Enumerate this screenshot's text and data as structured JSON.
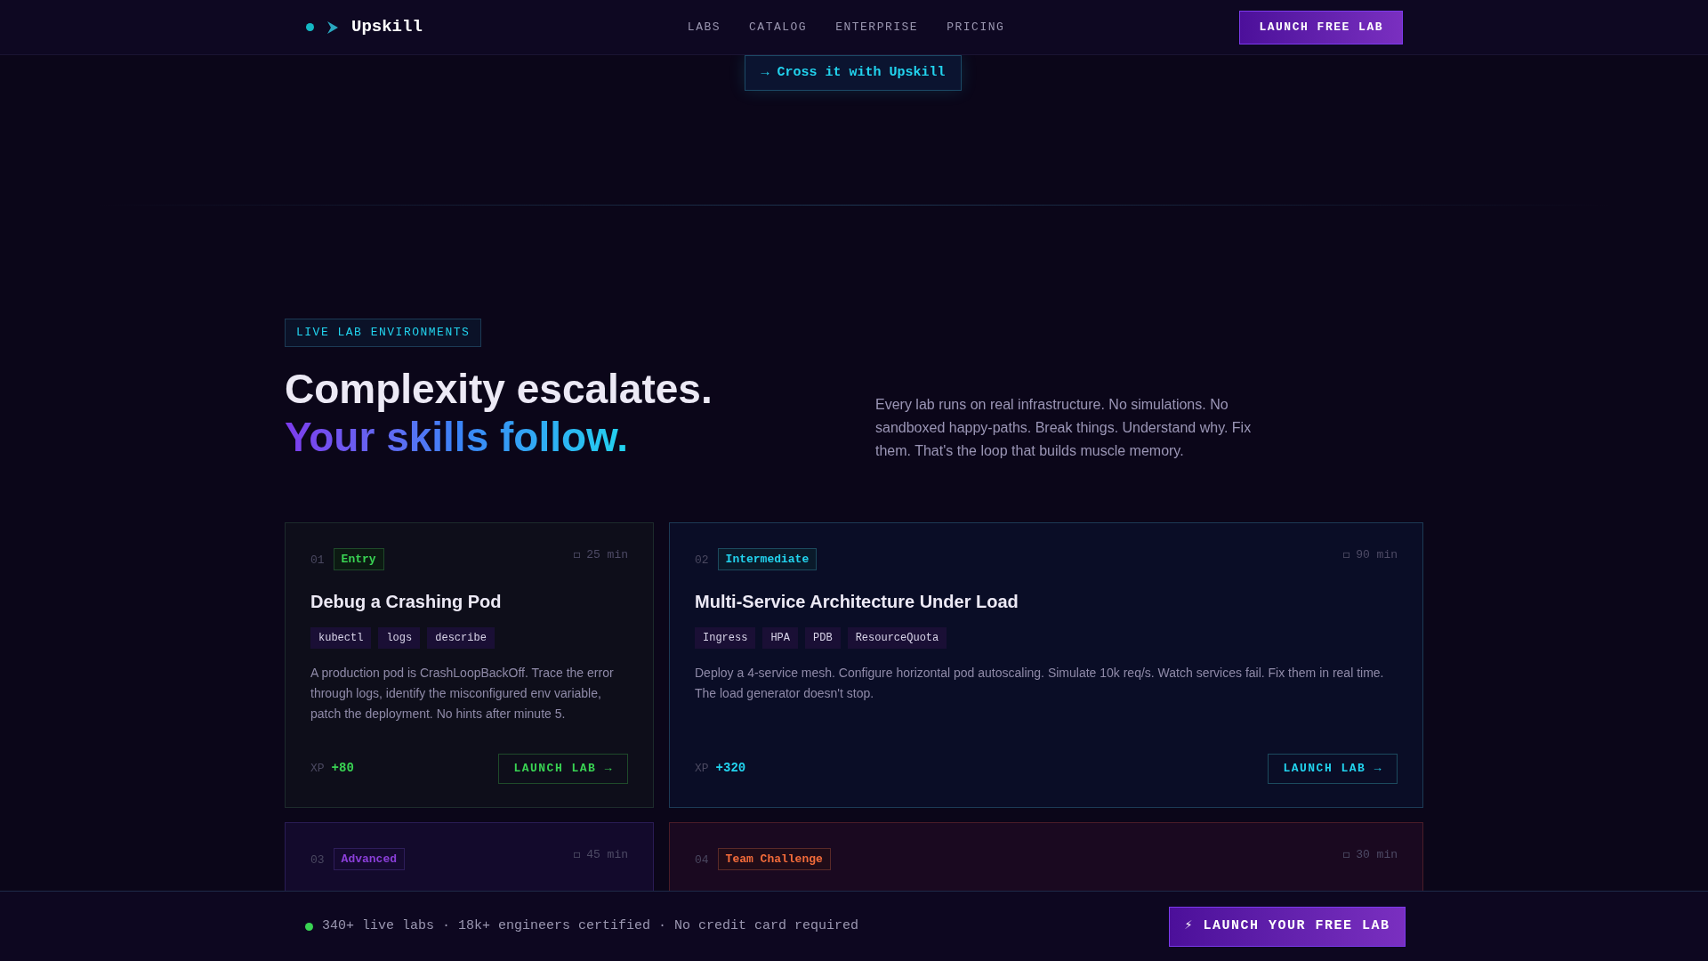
{
  "nav": {
    "brand": "Upskill",
    "links": [
      "LABS",
      "CATALOG",
      "ENTERPRISE",
      "PRICING"
    ],
    "cta": "LAUNCH FREE LAB"
  },
  "cross_button": "→ Cross it with Upskill",
  "section": {
    "badge": "LIVE LAB ENVIRONMENTS",
    "heading_line_1": "Complexity escalates.",
    "heading_line_2": "Your skills follow.",
    "description": "Every lab runs on real infrastructure. No simulations. No sandboxed happy-paths. Break things. Understand why. Fix them. That's the loop that builds muscle memory."
  },
  "labs": [
    {
      "number": "01",
      "kind": "entry",
      "level": "Entry",
      "duration": "25 min",
      "title": "Debug a Crashing Pod",
      "tags": [
        "kubectl",
        "logs",
        "describe"
      ],
      "description": "A production pod is CrashLoopBackOff. Trace the error through logs, identify the misconfigured env variable, patch the deployment. No hints after minute 5.",
      "xp_label": "XP",
      "xp": "+80",
      "button": "LAUNCH LAB →"
    },
    {
      "number": "02",
      "kind": "intermediate",
      "level": "Intermediate",
      "duration": "90 min",
      "title": "Multi-Service Architecture Under Load",
      "tags": [
        "Ingress",
        "HPA",
        "PDB",
        "ResourceQuota"
      ],
      "description": "Deploy a 4-service mesh. Configure horizontal pod autoscaling. Simulate 10k req/s. Watch services fail. Fix them in real time. The load generator doesn't stop.",
      "xp_label": "XP",
      "xp": "+320",
      "button": "LAUNCH LAB →"
    },
    {
      "number": "03",
      "kind": "advanced",
      "level": "Advanced",
      "duration": "45 min"
    },
    {
      "number": "04",
      "kind": "team",
      "level": "Team Challenge",
      "duration": "30 min"
    }
  ],
  "footer_bar": {
    "status": "340+ live labs · 18k+ engineers certified · No credit card required",
    "cta": "⚡ LAUNCH YOUR FREE LAB"
  }
}
